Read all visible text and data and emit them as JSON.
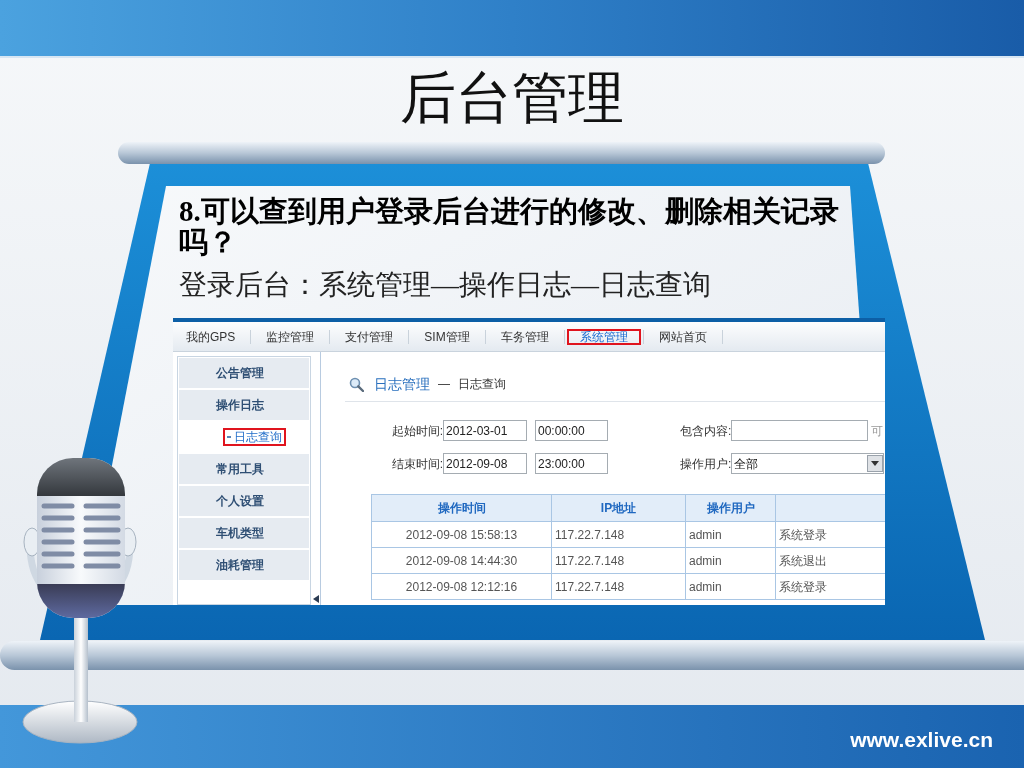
{
  "slide": {
    "title": "后台管理",
    "question": "8.可以查到用户登录后台进行的修改、删除相关记录吗？",
    "path": "登录后台：系统管理—操作日志—日志查询",
    "website": "www.exlive.cn"
  },
  "screenshot": {
    "nav_tabs": [
      {
        "label": "我的GPS",
        "selected": false,
        "highlighted": false
      },
      {
        "label": "监控管理",
        "selected": false,
        "highlighted": false
      },
      {
        "label": "支付管理",
        "selected": false,
        "highlighted": false
      },
      {
        "label": "SIM管理",
        "selected": false,
        "highlighted": false
      },
      {
        "label": "车务管理",
        "selected": false,
        "highlighted": false
      },
      {
        "label": "系统管理",
        "selected": true,
        "highlighted": true
      },
      {
        "label": "网站首页",
        "selected": false,
        "highlighted": false
      }
    ],
    "sidebar": {
      "items": [
        {
          "label": "公告管理",
          "selected": false
        },
        {
          "label": "操作日志",
          "selected": false,
          "children": [
            {
              "label": "日志查询",
              "selected": true,
              "highlighted": true
            }
          ]
        },
        {
          "label": "常用工具",
          "selected": false
        },
        {
          "label": "个人设置",
          "selected": false
        },
        {
          "label": "车机类型",
          "selected": false
        },
        {
          "label": "油耗管理",
          "selected": false
        }
      ]
    },
    "breadcrumb": {
      "section": "日志管理",
      "separator": "—",
      "page": "日志查询"
    },
    "filters": [
      {
        "kind": "range",
        "label": "起始时间:",
        "date": "2012-03-01",
        "time": "00:00:00"
      },
      {
        "kind": "text",
        "label": "包含内容:",
        "note": "可"
      },
      {
        "kind": "range",
        "label": "结束时间:",
        "date": "2012-09-08",
        "time": "23:00:00"
      },
      {
        "kind": "select",
        "label": "操作用户:",
        "value": "全部"
      }
    ],
    "table": {
      "columns": [
        "操作时间",
        "IP地址",
        "操作用户"
      ],
      "rows": [
        {
          "cells": [
            "2012-09-08 15:58:13",
            "117.22.7.148",
            "admin",
            "系统登录"
          ]
        },
        {
          "cells": [
            "2012-09-08 14:44:30",
            "117.22.7.148",
            "admin",
            "系统退出"
          ]
        },
        {
          "cells": [
            "2012-09-08 12:12:16",
            "117.22.7.148",
            "admin",
            "系统登录"
          ]
        }
      ]
    }
  }
}
